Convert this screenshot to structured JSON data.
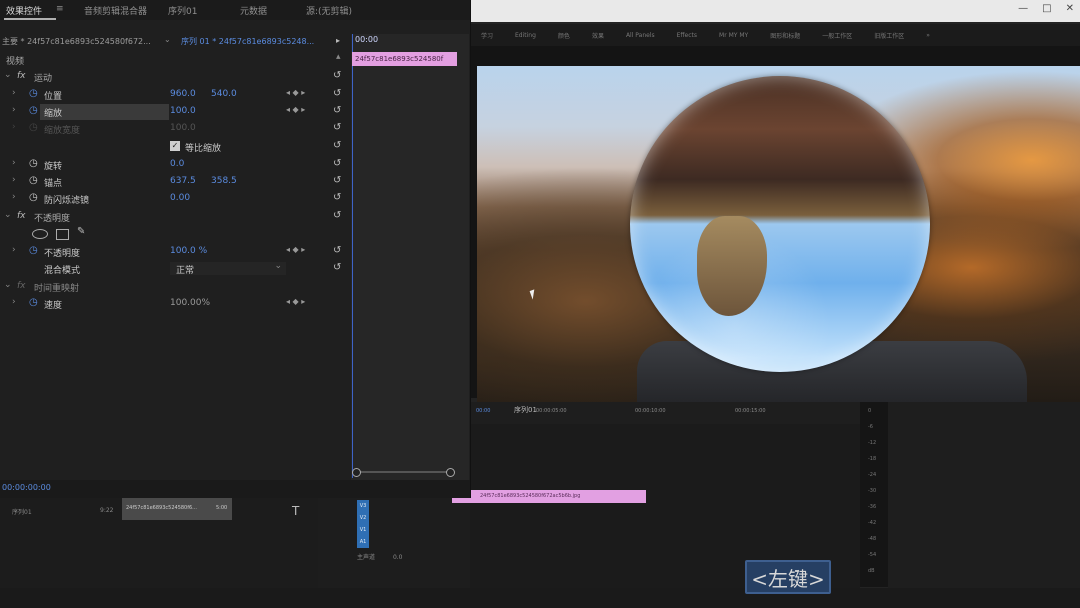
{
  "effect_controls": {
    "tabs": [
      {
        "label": "效果控件",
        "active": true
      },
      {
        "label": "≡",
        "active": false
      },
      {
        "label": "音频剪辑混合器",
        "active": false
      },
      {
        "label": "序列01",
        "active": false
      },
      {
        "label": "元数据",
        "active": false
      },
      {
        "label": "源:(无剪辑)",
        "active": false
      }
    ],
    "source_label": "主要 * 24f57c81e6893c524580f672...",
    "sequence_label": "序列 01 * 24f57c81e6893c5248...",
    "timecode_head": "00:00",
    "clip_label": "24f57c81e6893c524580f",
    "video_header": "视频",
    "rows": [
      {
        "type": "section",
        "label": "运动"
      },
      {
        "type": "param",
        "label": "位置",
        "values": [
          "960.0",
          "540.0"
        ],
        "keyframe": true
      },
      {
        "type": "param",
        "label": "缩放",
        "values": [
          "100.0"
        ],
        "keyframe": true,
        "highlight": true
      },
      {
        "type": "param",
        "label": "缩放宽度",
        "values": [
          "100.0"
        ],
        "disabled": true
      },
      {
        "type": "checkbox",
        "label": "等比缩放",
        "checked": true
      },
      {
        "type": "param",
        "label": "旋转",
        "values": [
          "0.0"
        ]
      },
      {
        "type": "param",
        "label": "锚点",
        "values": [
          "637.5",
          "358.5"
        ]
      },
      {
        "type": "param",
        "label": "防闪烁滤镜",
        "values": [
          "0.00"
        ]
      },
      {
        "type": "section",
        "label": "不透明度"
      },
      {
        "type": "tools"
      },
      {
        "type": "param",
        "label": "不透明度",
        "values": [
          "100.0 %"
        ],
        "keyframe": true
      },
      {
        "type": "select",
        "label": "混合模式",
        "value": "正常"
      },
      {
        "type": "section",
        "label": "时间重映射",
        "disabled": true
      },
      {
        "type": "param",
        "label": "速度",
        "values": [
          "100.00%"
        ],
        "keyframe": true
      }
    ],
    "bottom_timecode": "00:00:00:00"
  },
  "workspaces": [
    "学习",
    "Editing",
    "颜色",
    "效果",
    "All Panels",
    "Effects",
    "Mr MY MY",
    "图形和标题",
    "一般工作区",
    "旧版工作区",
    "»"
  ],
  "timeline": {
    "tab": "序列01",
    "timecode": "00:00",
    "ruler": [
      "00:00:05:00",
      "00:00:10:00",
      "00:00:15:00"
    ],
    "clip_label": "24f57c81e6893c524580f672ac5b6b.jpg",
    "tracks": [
      "V3",
      "V2",
      "V1",
      "A1"
    ],
    "master_label": "主声道",
    "master_value": "0.0"
  },
  "project": {
    "item_name": "24f57c81e6893c524580f6...",
    "item_duration": "5:00",
    "left_label": "序列01",
    "left_value": "9:22"
  },
  "meter_scale": [
    "0",
    "-6",
    "-12",
    "-18",
    "-24",
    "-30",
    "-36",
    "-42",
    "-48",
    "-54",
    "dB"
  ],
  "overlay_key": "<左键>"
}
